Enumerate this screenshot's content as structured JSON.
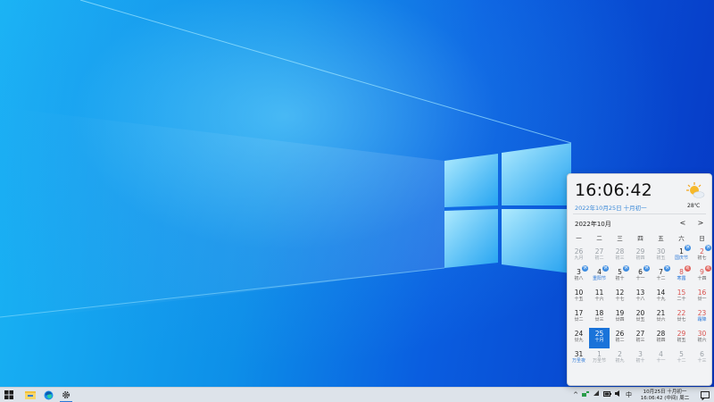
{
  "taskbar": {
    "apps": [
      {
        "name": "start-button",
        "icon": "windows-logo-icon"
      },
      {
        "name": "file-explorer-button",
        "icon": "folder-icon"
      },
      {
        "name": "edge-button",
        "icon": "edge-icon"
      },
      {
        "name": "settings-button",
        "icon": "gear-icon",
        "active": true
      }
    ],
    "tray": {
      "ime": "中",
      "clock_line1": "10月25日 十月初一",
      "clock_line2": "16:06:42 (中间) 周二"
    }
  },
  "flyout": {
    "time": "16:06:42",
    "date_line": "2022年10月25日 十月初一",
    "temperature": "28℃",
    "weather_icon": "sun-cloud-icon",
    "month_title": "2022年10月",
    "prev_label": "<",
    "next_label": ">",
    "weekdays": [
      "一",
      "二",
      "三",
      "四",
      "五",
      "六",
      "日"
    ],
    "weeks": [
      [
        {
          "d": "26",
          "l": "九月",
          "o": true
        },
        {
          "d": "27",
          "l": "初二",
          "o": true
        },
        {
          "d": "28",
          "l": "初三",
          "o": true
        },
        {
          "d": "29",
          "l": "初四",
          "o": true
        },
        {
          "d": "30",
          "l": "初五",
          "o": true
        },
        {
          "d": "1",
          "l": "国庆节",
          "b": "休",
          "hl": true
        },
        {
          "d": "2",
          "l": "初七",
          "b": "休",
          "we": true
        }
      ],
      [
        {
          "d": "3",
          "l": "初八",
          "b": "休"
        },
        {
          "d": "4",
          "l": "重阳节",
          "b": "休",
          "hl": true
        },
        {
          "d": "5",
          "l": "初十",
          "b": "休"
        },
        {
          "d": "6",
          "l": "十一",
          "b": "休"
        },
        {
          "d": "7",
          "l": "十二",
          "b": "休"
        },
        {
          "d": "8",
          "l": "寒露",
          "b": "班",
          "we": true,
          "hl": true
        },
        {
          "d": "9",
          "l": "十四",
          "b": "班",
          "we": true
        }
      ],
      [
        {
          "d": "10",
          "l": "十五"
        },
        {
          "d": "11",
          "l": "十六"
        },
        {
          "d": "12",
          "l": "十七"
        },
        {
          "d": "13",
          "l": "十八"
        },
        {
          "d": "14",
          "l": "十九"
        },
        {
          "d": "15",
          "l": "二十",
          "we": true
        },
        {
          "d": "16",
          "l": "廿一",
          "we": true
        }
      ],
      [
        {
          "d": "17",
          "l": "廿二"
        },
        {
          "d": "18",
          "l": "廿三"
        },
        {
          "d": "19",
          "l": "廿四"
        },
        {
          "d": "20",
          "l": "廿五"
        },
        {
          "d": "21",
          "l": "廿六"
        },
        {
          "d": "22",
          "l": "廿七",
          "we": true
        },
        {
          "d": "23",
          "l": "霜降",
          "we": true,
          "hl": true
        }
      ],
      [
        {
          "d": "24",
          "l": "廿九"
        },
        {
          "d": "25",
          "l": "十月",
          "today": true
        },
        {
          "d": "26",
          "l": "初二"
        },
        {
          "d": "27",
          "l": "初三"
        },
        {
          "d": "28",
          "l": "初四"
        },
        {
          "d": "29",
          "l": "初五",
          "we": true
        },
        {
          "d": "30",
          "l": "初六",
          "we": true
        }
      ],
      [
        {
          "d": "31",
          "l": "万圣夜",
          "hl": true
        },
        {
          "d": "1",
          "l": "万圣节",
          "o": true
        },
        {
          "d": "2",
          "l": "初九",
          "o": true
        },
        {
          "d": "3",
          "l": "初十",
          "o": true
        },
        {
          "d": "4",
          "l": "十一",
          "o": true
        },
        {
          "d": "5",
          "l": "十二",
          "o": true
        },
        {
          "d": "6",
          "l": "十三",
          "o": true
        }
      ]
    ]
  }
}
